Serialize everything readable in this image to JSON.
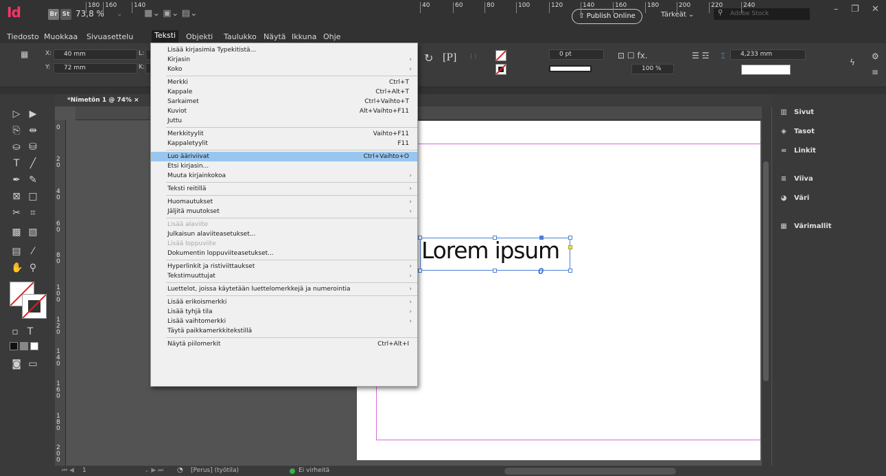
{
  "app": {
    "logo": "Id",
    "bridge": "Br",
    "stock_app": "St",
    "zoom": "73,8 %",
    "publish": "Publish Online",
    "workspace": "Tärkeät",
    "search_placeholder": "Adobe Stock"
  },
  "menubar": [
    "Tiedosto",
    "Muokkaa",
    "Sivuasettelu",
    "Teksti",
    "Objekti",
    "Taulukko",
    "Näytä",
    "Ikkuna",
    "Ohje"
  ],
  "control": {
    "x_label": "X:",
    "x_value": "40 mm",
    "y_label": "Y:",
    "y_value": "72 mm",
    "l_label": "L:",
    "k_label": "K:",
    "stroke_weight": "0 pt",
    "opacity": "100 %",
    "gutter": "4,233 mm"
  },
  "document": {
    "tab": "*Nimetön 1 @ 74%",
    "close": "×",
    "text": "Lorem ipsum"
  },
  "rulers": {
    "h": [
      "180",
      "160",
      "140",
      "40",
      "60",
      "80",
      "100",
      "120",
      "140",
      "160",
      "180",
      "200",
      "220",
      "240"
    ],
    "v": [
      "0",
      "2 0",
      "4 0",
      "6 0",
      "8 0",
      "1 0 0",
      "1 2 0",
      "1 4 0",
      "1 6 0",
      "1 8 0",
      "2 0 0"
    ]
  },
  "dropdown": [
    {
      "label": "Lisää kirjasimia Typekitistä...",
      "shortcut": "",
      "submenu": false,
      "disabled": false
    },
    {
      "label": "Kirjasin",
      "shortcut": "",
      "submenu": true,
      "disabled": false
    },
    {
      "label": "Koko",
      "shortcut": "",
      "submenu": true,
      "disabled": false
    },
    {
      "sep": true
    },
    {
      "label": "Merkki",
      "shortcut": "Ctrl+T",
      "submenu": false,
      "disabled": false
    },
    {
      "label": "Kappale",
      "shortcut": "Ctrl+Alt+T",
      "submenu": false,
      "disabled": false
    },
    {
      "label": "Sarkaimet",
      "shortcut": "Ctrl+Vaihto+T",
      "submenu": false,
      "disabled": false
    },
    {
      "label": "Kuviot",
      "shortcut": "Alt+Vaihto+F11",
      "submenu": false,
      "disabled": false
    },
    {
      "label": "Juttu",
      "shortcut": "",
      "submenu": false,
      "disabled": false
    },
    {
      "sep": true
    },
    {
      "label": "Merkkityylit",
      "shortcut": "Vaihto+F11",
      "submenu": false,
      "disabled": false
    },
    {
      "label": "Kappaletyylit",
      "shortcut": "F11",
      "submenu": false,
      "disabled": false
    },
    {
      "sep": true
    },
    {
      "label": "Luo ääriviivat",
      "shortcut": "Ctrl+Vaihto+O",
      "submenu": false,
      "disabled": false,
      "highlight": true
    },
    {
      "label": "Etsi kirjasin...",
      "shortcut": "",
      "submenu": false,
      "disabled": false
    },
    {
      "label": "Muuta kirjainkokoa",
      "shortcut": "",
      "submenu": true,
      "disabled": false
    },
    {
      "sep": true
    },
    {
      "label": "Teksti reitillä",
      "shortcut": "",
      "submenu": true,
      "disabled": false
    },
    {
      "sep": true
    },
    {
      "label": "Huomautukset",
      "shortcut": "",
      "submenu": true,
      "disabled": false
    },
    {
      "label": "Jäljitä muutokset",
      "shortcut": "",
      "submenu": true,
      "disabled": false
    },
    {
      "sep": true
    },
    {
      "label": "Lisää alaviite",
      "shortcut": "",
      "submenu": false,
      "disabled": true
    },
    {
      "label": "Julkaisun alaviiteasetukset...",
      "shortcut": "",
      "submenu": false,
      "disabled": false
    },
    {
      "label": "Lisää loppuviite",
      "shortcut": "",
      "submenu": false,
      "disabled": true
    },
    {
      "label": "Dokumentin loppuviiteasetukset...",
      "shortcut": "",
      "submenu": false,
      "disabled": false
    },
    {
      "sep": true
    },
    {
      "label": "Hyperlinkit ja ristiviittaukset",
      "shortcut": "",
      "submenu": true,
      "disabled": false
    },
    {
      "label": "Tekstimuuttujat",
      "shortcut": "",
      "submenu": true,
      "disabled": false
    },
    {
      "sep": true
    },
    {
      "label": "Luettelot, joissa käytetään luettelomerkkejä ja numerointia",
      "shortcut": "",
      "submenu": true,
      "disabled": false
    },
    {
      "sep": true
    },
    {
      "label": "Lisää erikoismerkki",
      "shortcut": "",
      "submenu": true,
      "disabled": false
    },
    {
      "label": "Lisää tyhjä tila",
      "shortcut": "",
      "submenu": true,
      "disabled": false
    },
    {
      "label": "Lisää vaihtomerkki",
      "shortcut": "",
      "submenu": true,
      "disabled": false
    },
    {
      "label": "Täytä paikkamerkkitekstillä",
      "shortcut": "",
      "submenu": false,
      "disabled": false
    },
    {
      "sep": true
    },
    {
      "label": "Näytä piilomerkit",
      "shortcut": "Ctrl+Alt+I",
      "submenu": false,
      "disabled": false
    }
  ],
  "panels": [
    {
      "label": "Sivut",
      "icon": "pages-icon"
    },
    {
      "label": "Tasot",
      "icon": "layers-icon"
    },
    {
      "label": "Linkit",
      "icon": "links-icon"
    },
    {
      "label": "Viiva",
      "icon": "stroke-icon"
    },
    {
      "label": "Väri",
      "icon": "color-icon"
    },
    {
      "label": "Värimallit",
      "icon": "swatches-icon"
    }
  ],
  "status": {
    "page": "1",
    "style": "[Perus] (työtila)",
    "errors": "Ei virheitä"
  },
  "colors": {
    "accent": "#99c6ee",
    "logo": "#ff3366",
    "margin": "#d56ad5",
    "frame": "#4a7fd4",
    "ok": "#3cb043"
  }
}
